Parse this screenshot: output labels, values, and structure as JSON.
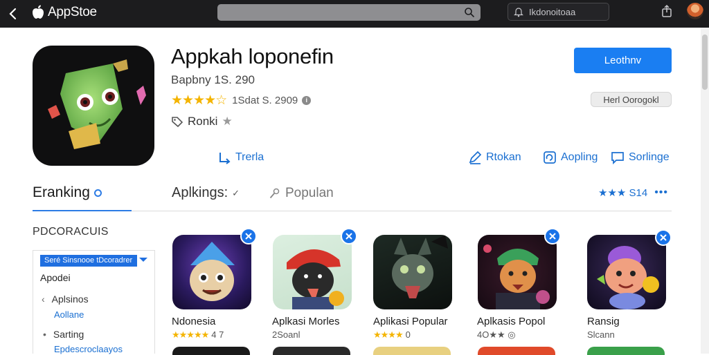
{
  "topbar": {
    "brand": "AppStoe",
    "search_placeholder": "",
    "account_label": "Ikdonoitoaa"
  },
  "app": {
    "title": "Appkah loponefin",
    "subtitle": "Bapbny 1S. 290",
    "stars": "★★★★☆",
    "rating_text": "1Sdat S. 2909",
    "rank_label": "Ronki",
    "primary_button": "Leothnv",
    "genre_chip": "Herl Oorogokl",
    "actions": {
      "left": "Trerla",
      "share": "Rtokan",
      "appling": "Aopling",
      "settings": "Sorlinge"
    }
  },
  "tabs": {
    "ranking": "Eranking",
    "apps": "Aplkings:",
    "popular": "Populan",
    "rating": "★★★ S14",
    "more": "•••"
  },
  "sidebar": {
    "heading": "PDCORACUIS",
    "select_value": "Seré Sinsnooe tDcoradrer",
    "title": "Apodei",
    "items": [
      "Aplsinos",
      "Sarting"
    ],
    "links": [
      "Aollane",
      "Epdescroclaayos"
    ]
  },
  "grid": [
    {
      "name": "Ndonesia",
      "rating": "4 7",
      "stars": "★★★★★"
    },
    {
      "name": "Aplkasi Morles",
      "meta": "2Soanl"
    },
    {
      "name": "Aplikasi Popular",
      "rating": "0",
      "stars": "★★★★"
    },
    {
      "name": "Aplkasis Popol",
      "meta": "4O★★ ◎"
    },
    {
      "name": "Ransig",
      "meta": "Slcann"
    }
  ],
  "colors": {
    "accent": "#1a7ef2",
    "star": "#f4b400",
    "topbar": "#1c1c1e"
  }
}
